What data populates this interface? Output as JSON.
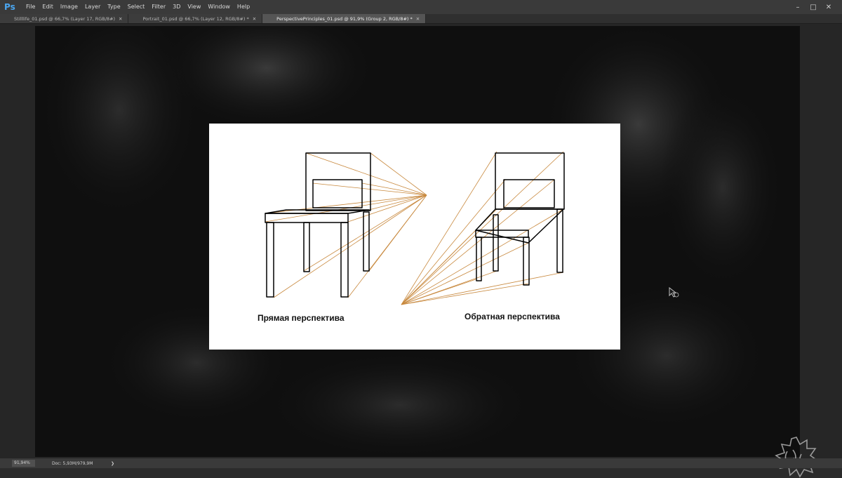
{
  "app": {
    "logo": "Ps"
  },
  "menu": [
    "File",
    "Edit",
    "Image",
    "Layer",
    "Type",
    "Select",
    "Filter",
    "3D",
    "View",
    "Window",
    "Help"
  ],
  "window_controls": [
    "–",
    "□",
    "✕"
  ],
  "tabs": [
    {
      "label": "Stilllife_01.psd @ 66,7% (Layer 17, RGB/8#)",
      "active": false
    },
    {
      "label": "Portrait_01.psd @ 66,7% (Layer 12, RGB/8#) *",
      "active": false
    },
    {
      "label": "PerspectivePrinciples_01.psd @ 91,9% (Group 2, RGB/8#) *",
      "active": true
    }
  ],
  "tab_close": "✕",
  "image": {
    "caption_left": "Прямая перспектива",
    "caption_right": "Обратная перспектива"
  },
  "status": {
    "zoom": "91,94%",
    "doc": "Doc: 5,93M/979,9M",
    "arrow": "❯"
  },
  "colors": {
    "accent_line": "#c8893e",
    "ps_blue": "#4aa6f0"
  }
}
